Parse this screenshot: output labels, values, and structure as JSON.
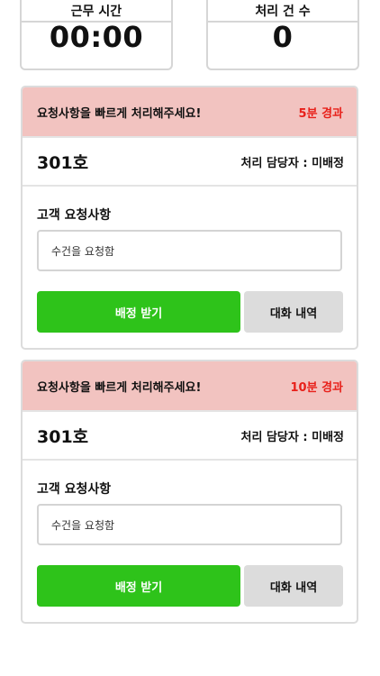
{
  "stats": {
    "work_time": {
      "label": "근무 시간",
      "value": "00:00"
    },
    "processed": {
      "label": "처리 건 수",
      "value": "0"
    }
  },
  "cards": [
    {
      "alert": "요청사항을 빠르게 처리해주세요!",
      "elapsed": "5분 경과",
      "room": "301호",
      "assignee": "처리 담당자 : 미배정",
      "request_label": "고객 요청사항",
      "request_text": "수건을 요청함",
      "assign_button": "배정 받기",
      "chat_button": "대화 내역"
    },
    {
      "alert": "요청사항을 빠르게 처리해주세요!",
      "elapsed": "10분 경과",
      "room": "301호",
      "assignee": "처리 담당자 : 미배정",
      "request_label": "고객 요청사항",
      "request_text": "수건을 요청함",
      "assign_button": "배정 받기",
      "chat_button": "대화 내역"
    }
  ],
  "colors": {
    "alert_bg": "#f2c3c0",
    "elapsed_text": "#e8201a",
    "assign_button": "#2ec31a",
    "chat_button": "#dcdcdc"
  }
}
